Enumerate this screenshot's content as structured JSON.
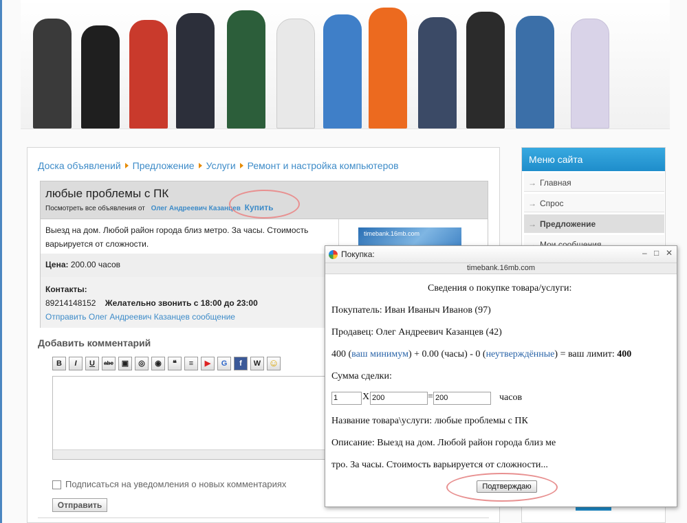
{
  "breadcrumbs": [
    "Доска объявлений",
    "Предложение",
    "Услуги",
    "Ремонт и настройка компьютеров"
  ],
  "ad": {
    "title": "любые проблемы с ПК",
    "sub_prefix": "Посмотреть все объявления от",
    "author": "Олег Андреевич Казанцев",
    "buy_link": "Купить",
    "description": "Выезд на дом. Любой район города близ метро. За часы. Стоимость варьируется от сложности.",
    "price_label": "Цена:",
    "price_value": "200.00 часов",
    "contacts_label": "Контакты:",
    "phone": "89214148152",
    "call_note": "Желательно звонить с 18:00 до 23:00",
    "message_link": "Отправить Олег Андреевич Казанцев сообщение",
    "thumb_text": "timebank.16mb.com"
  },
  "comment": {
    "heading": "Добавить комментарий",
    "toolbar": [
      {
        "label": "B",
        "icon": "bold-icon"
      },
      {
        "label": "I",
        "icon": "italic-icon"
      },
      {
        "label": "U",
        "icon": "underline-icon"
      },
      {
        "label": "abc",
        "icon": "strikethrough-icon"
      },
      {
        "label": "▣",
        "icon": "image-icon"
      },
      {
        "label": "◎",
        "icon": "link-icon"
      },
      {
        "label": "◉",
        "icon": "hide-icon"
      },
      {
        "label": "❝",
        "icon": "quote-icon"
      },
      {
        "label": "≡",
        "icon": "list-icon"
      },
      {
        "label": "▶",
        "icon": "youtube-icon"
      },
      {
        "label": "G",
        "icon": "google-icon"
      },
      {
        "label": "f",
        "icon": "facebook-icon"
      },
      {
        "label": "W",
        "icon": "wikipedia-icon"
      },
      {
        "label": "☺",
        "icon": "smiley-icon"
      }
    ],
    "subscribe_label": "Подписаться на уведомления о новых комментариях",
    "send_label": "Отправить"
  },
  "sidebar": {
    "title": "Меню сайта",
    "items": [
      "Главная",
      "Спрос",
      "Предложение",
      "Мои сообщения"
    ],
    "active": "Предложение"
  },
  "popup": {
    "title": "Покупка:",
    "url": "timebank.16mb.com",
    "heading": "Сведения о покупке товара/услуги:",
    "buyer": "Покупатель: Иван Иваныч Иванов (97)",
    "seller": "Продавец: Олег Андреевич Казанцев (42)",
    "limit_a": "400 (",
    "limit_link1": "ваш минимум",
    "limit_b": ") + 0.00 (часы) - 0 (",
    "limit_link2": "неутверждённые",
    "limit_c": ") = ваш лимит:",
    "limit_total": "400",
    "sum_label": "Сумма сделки:",
    "qty": "1",
    "times_sign": "X",
    "unit_price": "200",
    "equals_sign": "=",
    "total": "200",
    "unit": "часов",
    "item_name": "Название товара\\услуги: любые проблемы с ПК",
    "desc_line1": "Описание: Выезд на дом. Любой район города близ ме",
    "desc_line2": "тро. За часы. Стоимость варьируется от сложности...",
    "confirm_label": "Подтверждаю"
  },
  "colors": {
    "link": "#3d8bc8",
    "menu_header": "#1e8dcb",
    "callout": "#e89090"
  }
}
